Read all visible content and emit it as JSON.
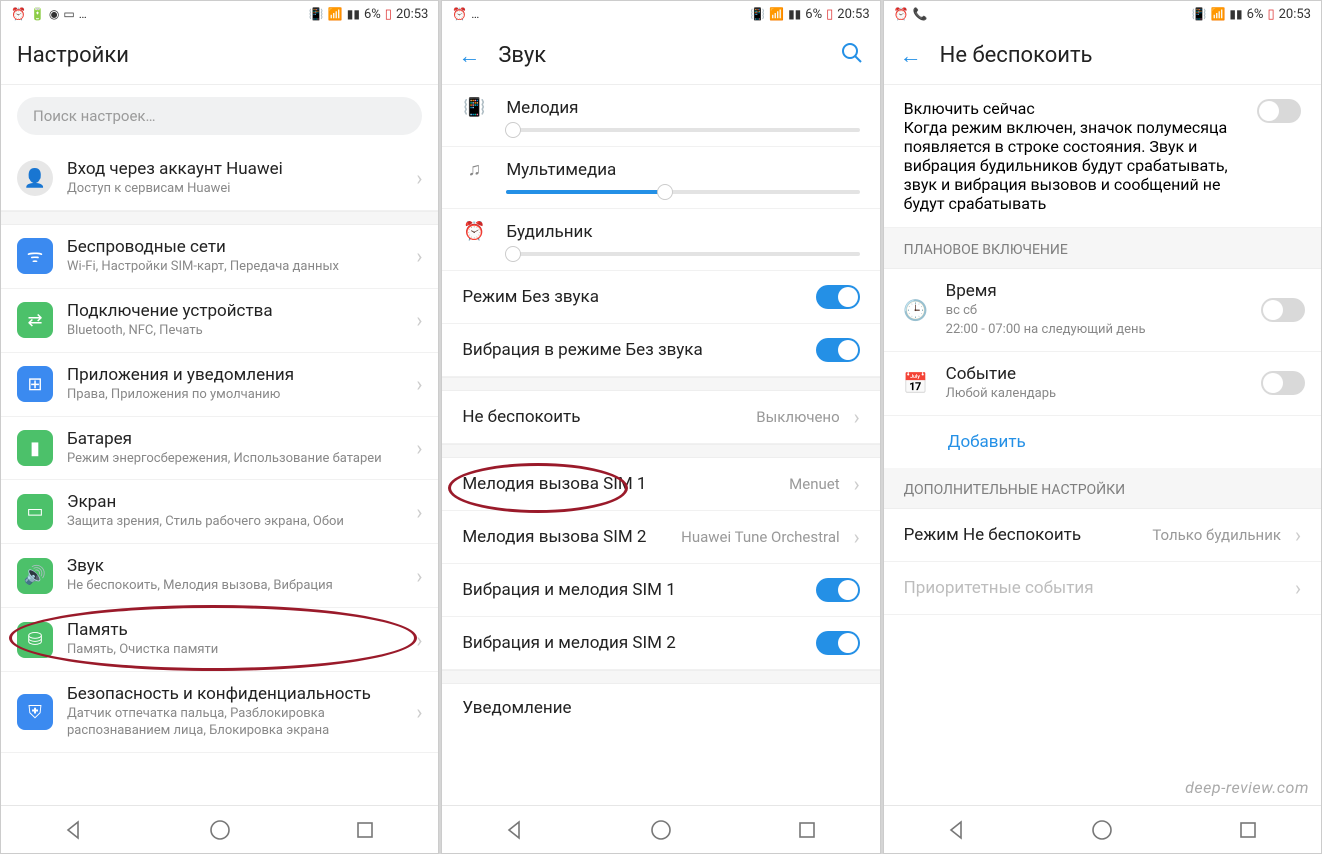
{
  "status": {
    "time": "20:53",
    "battery": "6%",
    "icons_left": [
      "alarm",
      "battery",
      "viber",
      "youtube",
      "more"
    ],
    "icons_right": [
      "vibrate",
      "wifi",
      "signal",
      "battery-low",
      "clock"
    ]
  },
  "s1": {
    "title": "Настройки",
    "search_placeholder": "Поиск настроек…",
    "account": {
      "title": "Вход через аккаунт Huawei",
      "sub": "Доступ к сервисам Huawei"
    },
    "items": [
      {
        "title": "Беспроводные сети",
        "sub": "Wi-Fi, Настройки SIM-карт, Передача данных",
        "color": "blue",
        "glyph": "wifi"
      },
      {
        "title": "Подключение устройства",
        "sub": "Bluetooth, NFC, Печать",
        "color": "green",
        "glyph": "device"
      },
      {
        "title": "Приложения и уведомления",
        "sub": "Права, Приложения по умолчанию",
        "color": "bluebox",
        "glyph": "apps"
      },
      {
        "title": "Батарея",
        "sub": "Режим энергосбережения, Использование батареи",
        "color": "green",
        "glyph": "battery"
      },
      {
        "title": "Экран",
        "sub": "Защита зрения, Стиль рабочего экрана, Обои",
        "color": "green",
        "glyph": "display"
      },
      {
        "title": "Звук",
        "sub": "Не беспокоить, Мелодия вызова, Вибрация",
        "color": "green",
        "glyph": "sound"
      },
      {
        "title": "Память",
        "sub": "Память, Очистка памяти",
        "color": "green",
        "glyph": "storage"
      },
      {
        "title": "Безопасность и конфиденциальность",
        "sub": "Датчик отпечатка пальца, Разблокировка распознаванием лица, Блокировка экрана",
        "color": "bluebox",
        "glyph": "security"
      }
    ]
  },
  "s2": {
    "title": "Звук",
    "sliders": [
      {
        "label": "Мелодия",
        "pos": 2
      },
      {
        "label": "Мультимедиа",
        "pos": 45
      },
      {
        "label": "Будильник",
        "pos": 2
      }
    ],
    "toggles": [
      {
        "label": "Режим Без звука",
        "on": true
      },
      {
        "label": "Вибрация в режиме Без звука",
        "on": true
      }
    ],
    "dnd": {
      "label": "Не беспокоить",
      "value": "Выключено"
    },
    "sim1": {
      "label": "Мелодия вызова SIM 1",
      "value": "Menuet"
    },
    "sim2": {
      "label": "Мелодия вызова SIM 2",
      "value": "Huawei Tune Orchestral"
    },
    "vibtoggles": [
      {
        "label": "Вибрация и мелодия SIM 1",
        "on": true
      },
      {
        "label": "Вибрация и мелодия SIM 2",
        "on": true
      }
    ],
    "notif": {
      "label": "Уведомление"
    }
  },
  "s3": {
    "title": "Не беспокоить",
    "enable": {
      "title": "Включить сейчас",
      "sub": "Когда режим включен, значок полумесяца появляется в строке состояния. Звук и вибрация будильников будут срабатывать, звук и вибрация вызовов и сообщений не будут срабатывать",
      "on": false
    },
    "section1": "ПЛАНОВОЕ ВКЛЮЧЕНИЕ",
    "time": {
      "title": "Время",
      "days": "вс сб",
      "range": "22:00 - 07:00 на следующий день",
      "on": false
    },
    "event": {
      "title": "Событие",
      "sub": "Любой календарь",
      "on": false
    },
    "add": "Добавить",
    "section2": "ДОПОЛНИТЕЛЬНЫЕ НАСТРОЙКИ",
    "mode": {
      "label": "Режим Не беспокоить",
      "value": "Только будильник"
    },
    "priority": "Приоритетные события"
  },
  "watermark": "deep-review.com"
}
